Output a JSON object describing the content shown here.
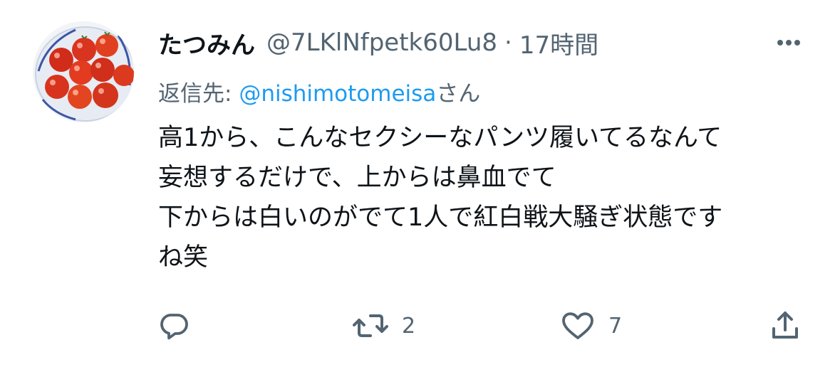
{
  "tweet": {
    "display_name": "たつみん",
    "handle": "@7LKlNfpetk60Lu8",
    "separator": "·",
    "time": "17時間",
    "replying_prefix": "返信先: ",
    "replying_to": "@nishimotomeisa",
    "replying_suffix": "さん",
    "body_lines": [
      "高1から、こんなセクシーなパンツ履いてるなんて",
      "妄想するだけで、上からは鼻血でて",
      "下からは白いのがでて1人で紅白戦大騒ぎ状態です",
      "ね笑"
    ],
    "avatar_icon": "tomatoes-photo"
  },
  "actions": {
    "reply_icon": "reply-icon",
    "reply_count": "",
    "retweet_icon": "retweet-icon",
    "retweet_count": "2",
    "like_icon": "heart-icon",
    "like_count": "7",
    "share_icon": "share-icon",
    "more_icon": "more-icon"
  },
  "colors": {
    "text": "#0f1419",
    "secondary": "#536471",
    "link": "#1d9bf0",
    "background": "#ffffff"
  }
}
